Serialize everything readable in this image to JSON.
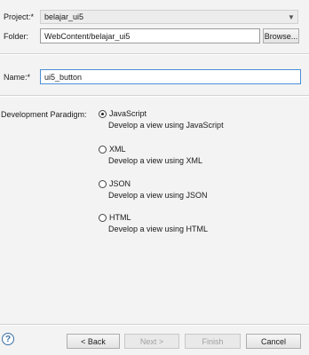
{
  "project": {
    "label": "Project:*",
    "value": "belajar_ui5"
  },
  "folder": {
    "label": "Folder:",
    "value": "WebContent/belajar_ui5",
    "browse_label": "Browse..."
  },
  "name": {
    "label": "Name:*",
    "value": "ui5_button"
  },
  "paradigm": {
    "label": "Development Paradigm:",
    "options": [
      {
        "label": "JavaScript",
        "desc": "Develop a view using JavaScript",
        "checked": true
      },
      {
        "label": "XML",
        "desc": "Develop a view using XML",
        "checked": false
      },
      {
        "label": "JSON",
        "desc": "Develop a view using JSON",
        "checked": false
      },
      {
        "label": "HTML",
        "desc": "Develop a view using HTML",
        "checked": false
      }
    ]
  },
  "footer": {
    "back": "< Back",
    "next": "Next >",
    "finish": "Finish",
    "cancel": "Cancel",
    "help": "?"
  }
}
